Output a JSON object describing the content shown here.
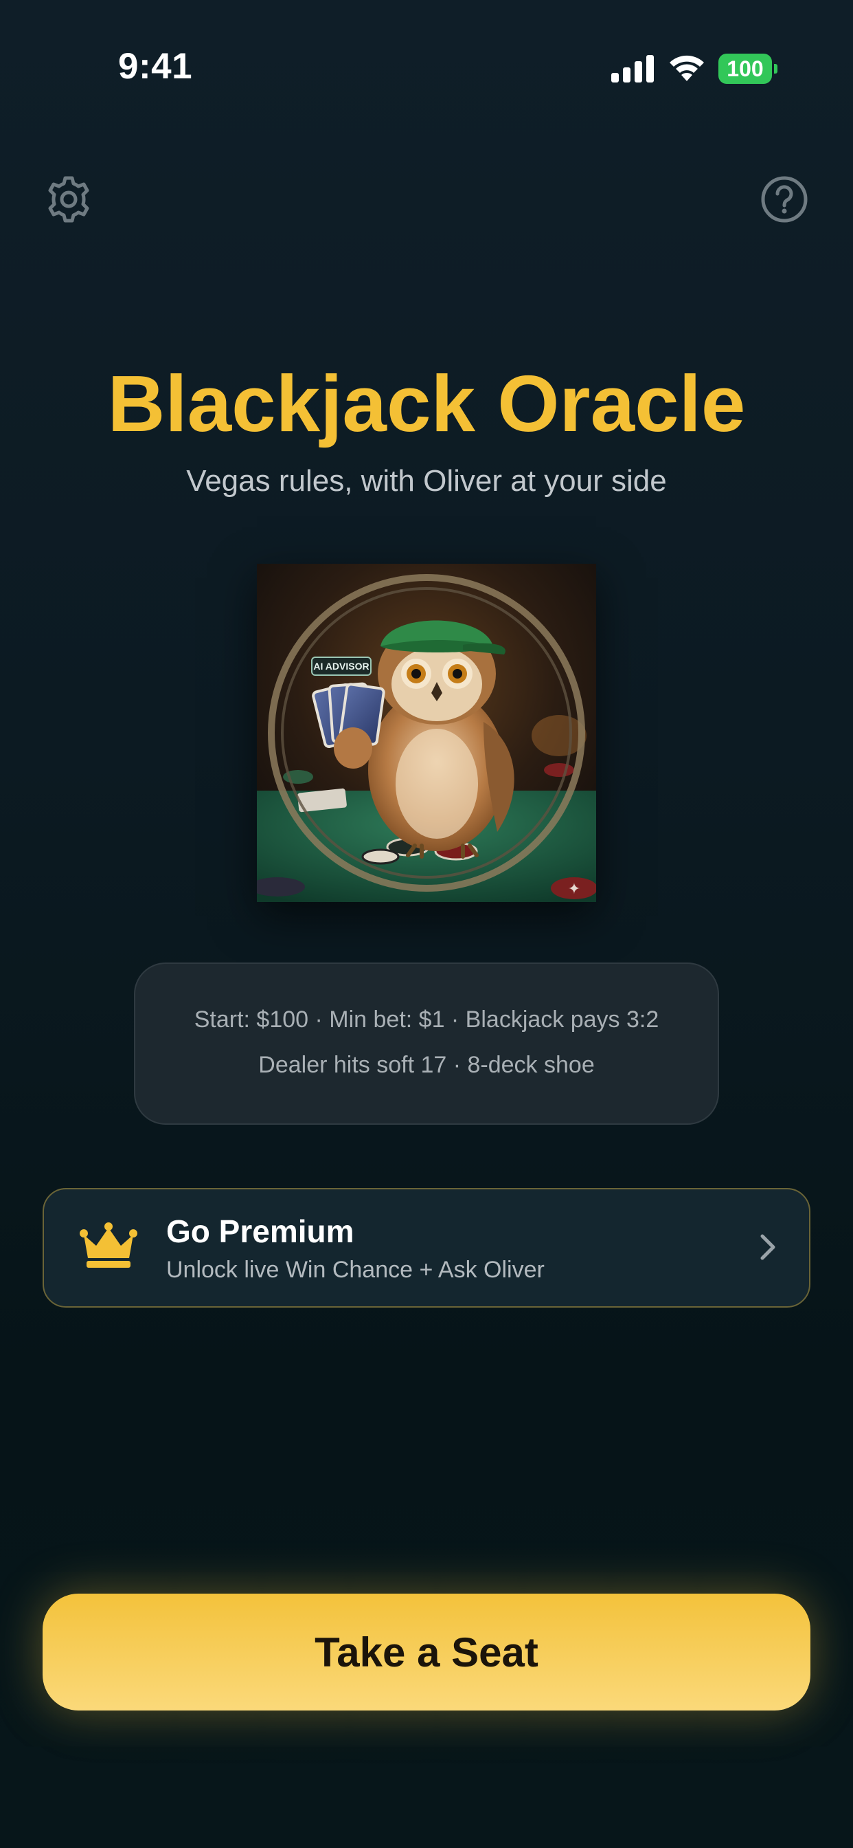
{
  "status_bar": {
    "time": "9:41",
    "battery_level": "100",
    "icons": [
      "cellular-signal-icon",
      "wifi-icon",
      "battery-icon"
    ]
  },
  "toolbar": {
    "left_icon": "gear-icon",
    "right_icon": "help-icon"
  },
  "header": {
    "title": "Blackjack Oracle",
    "subtitle": "Vegas rules, with Oliver at your side"
  },
  "hero_image": {
    "badge_text": "AI ADVISOR"
  },
  "rules": {
    "line1": "Start: $100 · Min bet: $1 · Blackjack pays 3:2",
    "line2": "Dealer hits soft 17 · 8-deck shoe"
  },
  "premium": {
    "icon": "crown-icon",
    "title": "Go Premium",
    "subtitle": "Unlock live Win Chance + Ask Oliver"
  },
  "cta": {
    "label": "Take a Seat"
  },
  "colors": {
    "accent": "#f4c035",
    "background": "#0c1a22",
    "battery": "#32c759"
  }
}
